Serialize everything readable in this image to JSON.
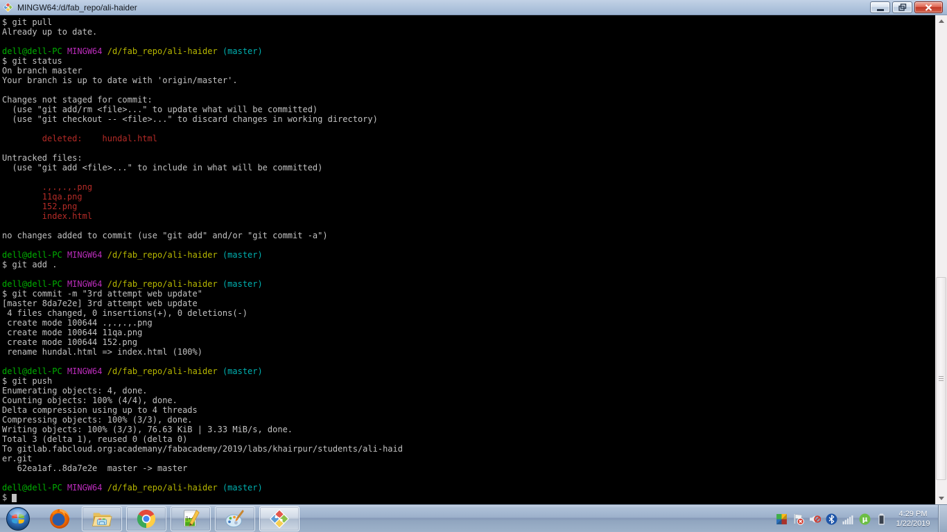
{
  "window": {
    "title": "MINGW64:/d/fab_repo/ali-haider",
    "app_icon": "git-bash-diamond-icon",
    "controls": [
      "minimize",
      "restore",
      "close"
    ]
  },
  "colors": {
    "def": "#C2C2C2",
    "green": "#00B000",
    "magenta": "#BB2CBB",
    "yellow": "#B8B800",
    "cyan": "#00B0B0",
    "red": "#B52B27",
    "cursor": "#C2C2C2"
  },
  "terminal": {
    "lines": [
      [
        [
          "def",
          "$ git pull"
        ]
      ],
      [
        [
          "def",
          "Already up to date."
        ]
      ],
      [],
      [
        [
          "green",
          "dell@dell-PC"
        ],
        [
          "def",
          " "
        ],
        [
          "magenta",
          "MINGW64"
        ],
        [
          "def",
          " "
        ],
        [
          "yellow",
          "/d/fab_repo/ali-haider"
        ],
        [
          "def",
          " "
        ],
        [
          "cyan",
          "(master)"
        ]
      ],
      [
        [
          "def",
          "$ git status"
        ]
      ],
      [
        [
          "def",
          "On branch master"
        ]
      ],
      [
        [
          "def",
          "Your branch is up to date with 'origin/master'."
        ]
      ],
      [],
      [
        [
          "def",
          "Changes not staged for commit:"
        ]
      ],
      [
        [
          "def",
          "  (use \"git add/rm <file>...\" to update what will be committed)"
        ]
      ],
      [
        [
          "def",
          "  (use \"git checkout -- <file>...\" to discard changes in working directory)"
        ]
      ],
      [],
      [
        [
          "red",
          "        deleted:    hundal.html"
        ]
      ],
      [],
      [
        [
          "def",
          "Untracked files:"
        ]
      ],
      [
        [
          "def",
          "  (use \"git add <file>...\" to include in what will be committed)"
        ]
      ],
      [],
      [
        [
          "red",
          "        .,.,.,.png"
        ]
      ],
      [
        [
          "red",
          "        11qa.png"
        ]
      ],
      [
        [
          "red",
          "        152.png"
        ]
      ],
      [
        [
          "red",
          "        index.html"
        ]
      ],
      [],
      [
        [
          "def",
          "no changes added to commit (use \"git add\" and/or \"git commit -a\")"
        ]
      ],
      [],
      [
        [
          "green",
          "dell@dell-PC"
        ],
        [
          "def",
          " "
        ],
        [
          "magenta",
          "MINGW64"
        ],
        [
          "def",
          " "
        ],
        [
          "yellow",
          "/d/fab_repo/ali-haider"
        ],
        [
          "def",
          " "
        ],
        [
          "cyan",
          "(master)"
        ]
      ],
      [
        [
          "def",
          "$ git add ."
        ]
      ],
      [],
      [
        [
          "green",
          "dell@dell-PC"
        ],
        [
          "def",
          " "
        ],
        [
          "magenta",
          "MINGW64"
        ],
        [
          "def",
          " "
        ],
        [
          "yellow",
          "/d/fab_repo/ali-haider"
        ],
        [
          "def",
          " "
        ],
        [
          "cyan",
          "(master)"
        ]
      ],
      [
        [
          "def",
          "$ git commit -m \"3rd attempt web update\""
        ]
      ],
      [
        [
          "def",
          "[master 8da7e2e] 3rd attempt web update"
        ]
      ],
      [
        [
          "def",
          " 4 files changed, 0 insertions(+), 0 deletions(-)"
        ]
      ],
      [
        [
          "def",
          " create mode 100644 .,.,.,.png"
        ]
      ],
      [
        [
          "def",
          " create mode 100644 11qa.png"
        ]
      ],
      [
        [
          "def",
          " create mode 100644 152.png"
        ]
      ],
      [
        [
          "def",
          " rename hundal.html => index.html (100%)"
        ]
      ],
      [],
      [
        [
          "green",
          "dell@dell-PC"
        ],
        [
          "def",
          " "
        ],
        [
          "magenta",
          "MINGW64"
        ],
        [
          "def",
          " "
        ],
        [
          "yellow",
          "/d/fab_repo/ali-haider"
        ],
        [
          "def",
          " "
        ],
        [
          "cyan",
          "(master)"
        ]
      ],
      [
        [
          "def",
          "$ git push"
        ]
      ],
      [
        [
          "def",
          "Enumerating objects: 4, done."
        ]
      ],
      [
        [
          "def",
          "Counting objects: 100% (4/4), done."
        ]
      ],
      [
        [
          "def",
          "Delta compression using up to 4 threads"
        ]
      ],
      [
        [
          "def",
          "Compressing objects: 100% (3/3), done."
        ]
      ],
      [
        [
          "def",
          "Writing objects: 100% (3/3), 76.63 KiB | 3.33 MiB/s, done."
        ]
      ],
      [
        [
          "def",
          "Total 3 (delta 1), reused 0 (delta 0)"
        ]
      ],
      [
        [
          "def",
          "To gitlab.fabcloud.org:academany/fabacademy/2019/labs/khairpur/students/ali-haid"
        ]
      ],
      [
        [
          "def",
          "er.git"
        ]
      ],
      [
        [
          "def",
          "   62ea1af..8da7e2e  master -> master"
        ]
      ],
      [],
      [
        [
          "green",
          "dell@dell-PC"
        ],
        [
          "def",
          " "
        ],
        [
          "magenta",
          "MINGW64"
        ],
        [
          "def",
          " "
        ],
        [
          "yellow",
          "/d/fab_repo/ali-haider"
        ],
        [
          "def",
          " "
        ],
        [
          "cyan",
          "(master)"
        ]
      ],
      [
        [
          "def",
          "$ "
        ],
        [
          "cursor",
          ""
        ]
      ]
    ]
  },
  "taskbar": {
    "start": "start-orb",
    "pinned": [
      "firefox-icon"
    ],
    "buttons": [
      "windows-explorer",
      "google-chrome",
      "notepad-plus-plus",
      "paint",
      "git-bash"
    ],
    "active_button": "git-bash",
    "tray_icons": [
      "avg-antivirus",
      "action-center-flag-error",
      "volume-muted",
      "bluetooth",
      "network-signal",
      "utorrent",
      "battery"
    ],
    "clock": {
      "time": "4:29 PM",
      "date": "1/22/2019"
    }
  }
}
